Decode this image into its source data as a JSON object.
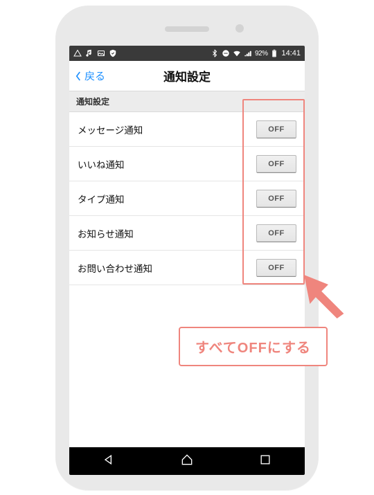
{
  "statusbar": {
    "battery_text": "92%",
    "time": "14:41"
  },
  "header": {
    "back_label": "戻る",
    "title": "通知設定"
  },
  "section": {
    "title": "通知設定"
  },
  "rows": [
    {
      "label": "メッセージ通知",
      "toggle": "OFF"
    },
    {
      "label": "いいね通知",
      "toggle": "OFF"
    },
    {
      "label": "タイプ通知",
      "toggle": "OFF"
    },
    {
      "label": "お知らせ通知",
      "toggle": "OFF"
    },
    {
      "label": "お問い合わせ通知",
      "toggle": "OFF"
    }
  ],
  "signal_icon": "｜",
  "annotation": {
    "callout": "すべてOFFにする"
  },
  "colors": {
    "accent": "#1e90ff",
    "highlight": "#ef857d",
    "statusbar_bg": "#3a3a3a"
  }
}
